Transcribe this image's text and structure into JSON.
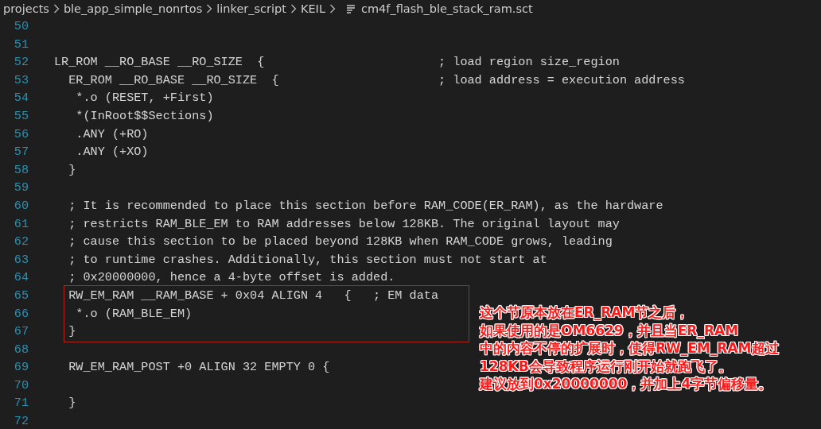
{
  "breadcrumb": [
    {
      "label": "projects",
      "kind": "folder"
    },
    {
      "label": "ble_app_simple_nonrtos",
      "kind": "folder"
    },
    {
      "label": "linker_script",
      "kind": "folder"
    },
    {
      "label": "KEIL",
      "kind": "folder"
    },
    {
      "label": "cm4f_flash_ble_stack_ram.sct",
      "kind": "file"
    }
  ],
  "lines": [
    {
      "number": "50",
      "boxed": false
    },
    {
      "number": "51",
      "boxed": false
    },
    {
      "number": "52",
      "code": "LR_ROM __RO_BASE __RO_SIZE  {                        ; load region size_region",
      "boxed": false
    },
    {
      "number": "53",
      "code": "  ER_ROM __RO_BASE __RO_SIZE  {                      ; load address = execution address",
      "boxed": false
    },
    {
      "number": "54",
      "code": "   *.o (RESET, +First)",
      "boxed": false
    },
    {
      "number": "55",
      "code": "   *(InRoot$$Sections)",
      "boxed": false
    },
    {
      "number": "56",
      "code": "   .ANY (+RO)",
      "boxed": false
    },
    {
      "number": "57",
      "code": "   .ANY (+XO)",
      "boxed": false
    },
    {
      "number": "58",
      "code": "  }",
      "boxed": false
    },
    {
      "number": "59",
      "boxed": false
    },
    {
      "number": "60",
      "code": "  ; It is recommended to place this section before RAM_CODE(ER_RAM), as the hardware",
      "boxed": false
    },
    {
      "number": "61",
      "code": "  ; restricts RAM_BLE_EM to RAM addresses below 128KB. The original layout may",
      "boxed": false
    },
    {
      "number": "62",
      "code": "  ; cause this section to be placed beyond 128KB when RAM_CODE grows, leading",
      "boxed": false
    },
    {
      "number": "63",
      "code": "  ; to runtime crashes. Additionally, this section must not start at",
      "boxed": false
    },
    {
      "number": "64",
      "code": "  ; 0x20000000, hence a 4-byte offset is added.",
      "boxed": false
    },
    {
      "number": "65",
      "code": "  RW_EM_RAM __RAM_BASE + 0x04 ALIGN 4   {   ; EM data",
      "boxed": true
    },
    {
      "number": "66",
      "code": "   *.o (RAM_BLE_EM)",
      "boxed": true
    },
    {
      "number": "67",
      "code": "  }",
      "boxed": true
    },
    {
      "number": "68",
      "boxed": false
    },
    {
      "number": "69",
      "code": "  RW_EM_RAM_POST +0 ALIGN 32 EMPTY 0 {",
      "boxed": false
    },
    {
      "number": "70",
      "boxed": false
    },
    {
      "number": "71",
      "code": "  }",
      "boxed": false
    },
    {
      "number": "72",
      "boxed": false
    }
  ],
  "annotation": [
    "这个节原本放在ER_RAM节之后，",
    "如果使用的是OM6629，并且当ER_RAM",
    "中的内容不停的扩展时，使得RW_EM_RAM超过",
    "128KB会导致程序运行刚开始就跑飞了。",
    "建议放到0x20000000，并加上4字节偏移量。"
  ]
}
